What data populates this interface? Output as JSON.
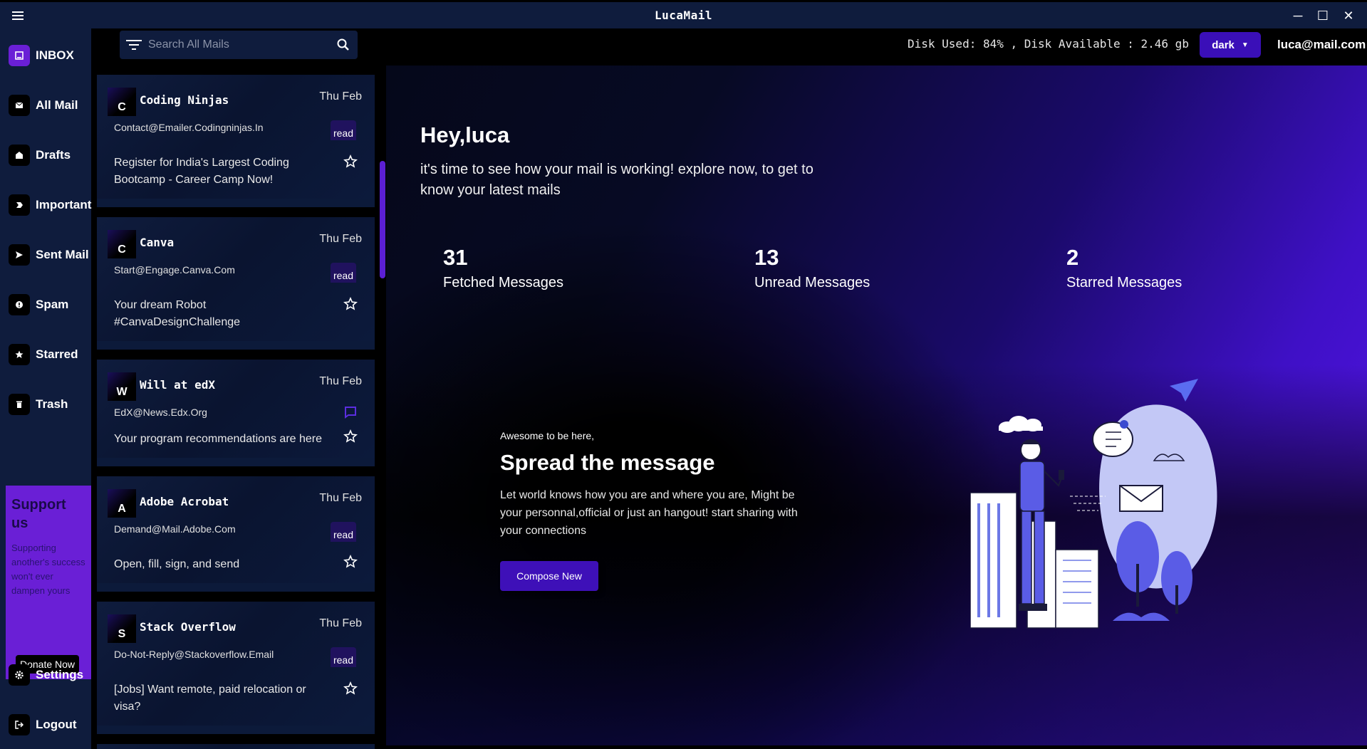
{
  "app": {
    "title": "LucaMail"
  },
  "window_controls": {
    "minimize": "─",
    "maximize": "☐",
    "close": "✕"
  },
  "sidebar": {
    "items": [
      {
        "label": "INBOX",
        "icon": "inbox-icon"
      },
      {
        "label": "All Mail",
        "icon": "mail-icon"
      },
      {
        "label": "Drafts",
        "icon": "drafts-icon"
      },
      {
        "label": "Important",
        "icon": "important-icon"
      },
      {
        "label": "Sent Mail",
        "icon": "send-icon"
      },
      {
        "label": "Spam",
        "icon": "spam-icon"
      },
      {
        "label": "Starred",
        "icon": "star-icon"
      },
      {
        "label": "Trash",
        "icon": "trash-icon"
      }
    ],
    "support": {
      "title": "Support us",
      "text": "Supporting another's success won't ever dampen yours",
      "button": "Donate Now"
    },
    "settings": "Settings",
    "logout": "Logout"
  },
  "search": {
    "placeholder": "Search All Mails"
  },
  "header": {
    "disk": "Disk Used: 84% , Disk Available : 2.46 gb",
    "theme": "dark",
    "user": "luca@mail.com"
  },
  "mails": [
    {
      "initial": "C",
      "sender": "Coding Ninjas",
      "date": "Thu Feb",
      "email": "Contact@Emailer.Codingninjas.In",
      "status": "read",
      "subject": "Register for India's Largest Coding Bootcamp - Career Camp Now!"
    },
    {
      "initial": "C",
      "sender": "Canva",
      "date": "Thu Feb",
      "email": "Start@Engage.Canva.Com",
      "status": "read",
      "subject": "Your dream Robot #CanvaDesignChallenge"
    },
    {
      "initial": "W",
      "sender": "Will at edX",
      "date": "Thu Feb",
      "email": "EdX@News.Edx.Org",
      "status": "",
      "subject": "Your program recommendations are here"
    },
    {
      "initial": "A",
      "sender": "Adobe Acrobat",
      "date": "Thu Feb",
      "email": "Demand@Mail.Adobe.Com",
      "status": "read",
      "subject": "Open, fill, sign, and send"
    },
    {
      "initial": "S",
      "sender": "Stack Overflow",
      "date": "Thu Feb",
      "email": "Do-Not-Reply@Stackoverflow.Email",
      "status": "read",
      "subject": "[Jobs] Want remote, paid relocation or visa?"
    }
  ],
  "main": {
    "greeting": "Hey,luca",
    "subtitle": "it's time to see how your mail is working! explore now, to get to know your latest mails",
    "stats": [
      {
        "value": "31",
        "label": "Fetched Messages"
      },
      {
        "value": "13",
        "label": "Unread Messages"
      },
      {
        "value": "2",
        "label": "Starred Messages"
      }
    ],
    "promo": {
      "small": "Awesome to be here,",
      "title": "Spread the message",
      "body": "Let world knows how you are and where you are, Might be your personnal,official or just an hangout! start sharing with your connections",
      "button": "Compose New"
    }
  },
  "colors": {
    "accent": "#6a1fd6",
    "sidebar": "#0f1c3d",
    "badge": "#20125e"
  }
}
